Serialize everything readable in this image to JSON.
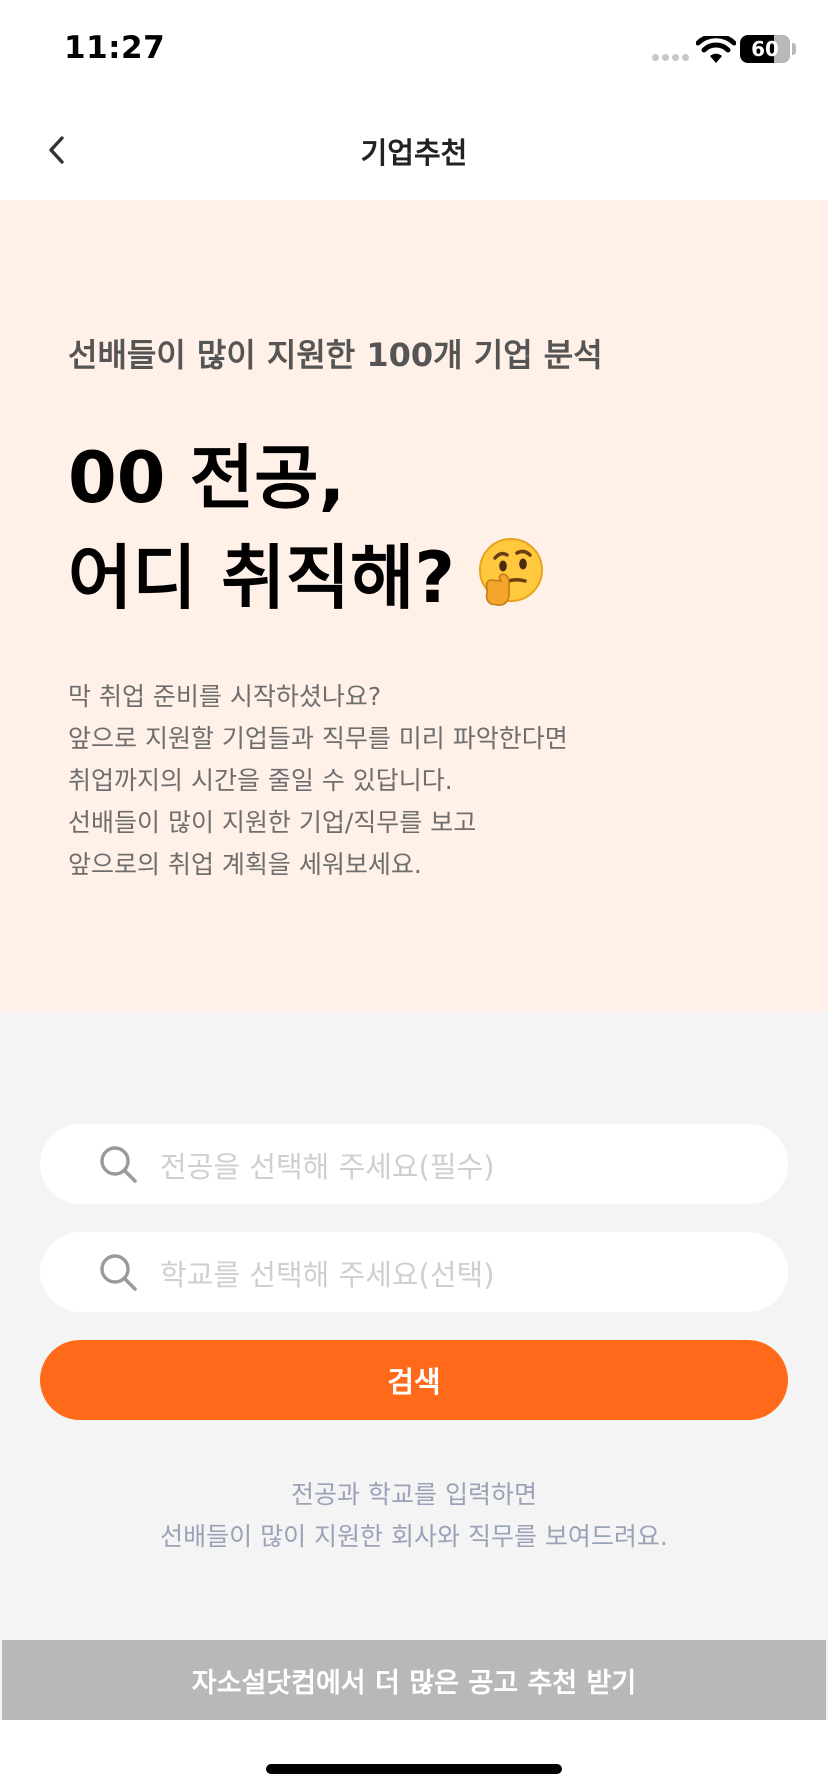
{
  "status_bar": {
    "time": "11:27",
    "battery_percent": "60",
    "icons": [
      "cellular-signal-icon",
      "wifi-icon",
      "battery-icon"
    ]
  },
  "nav": {
    "title": "기업추천",
    "back_icon": "chevron-left-icon"
  },
  "hero": {
    "subtitle": "선배들이 많이 지원한 100개 기업 분석",
    "title_line1": "00 전공,",
    "title_line2": "어디 취직해?",
    "emoji": "thinking-face-emoji",
    "description": [
      "막 취업 준비를 시작하셨나요?",
      "앞으로 지원할 기업들과 직무를 미리 파악한다면",
      "취업까지의 시간을 줄일 수 있답니다.",
      "선배들이 많이 지원한 기업/직무를 보고",
      "앞으로의 취업 계획을 세워보세요."
    ]
  },
  "search": {
    "major_placeholder": "전공을 선택해 주세요(필수)",
    "school_placeholder": "학교를 선택해 주세요(선택)",
    "button_label": "검색",
    "icon": "search-icon"
  },
  "helper": {
    "line1": "전공과 학교를 입력하면",
    "line2": "선배들이 많이 지원한 회사와 직무를 보여드려요."
  },
  "footer": {
    "more_button_label": "자소설닷컴에서 더 많은 공고 추천 받기"
  },
  "colors": {
    "accent": "#ff6a1a",
    "hero_background": "#fff0e8",
    "page_background": "#f4f4f4",
    "disabled_button": "#b8b8b8",
    "helper_text": "#9aa2b8"
  }
}
